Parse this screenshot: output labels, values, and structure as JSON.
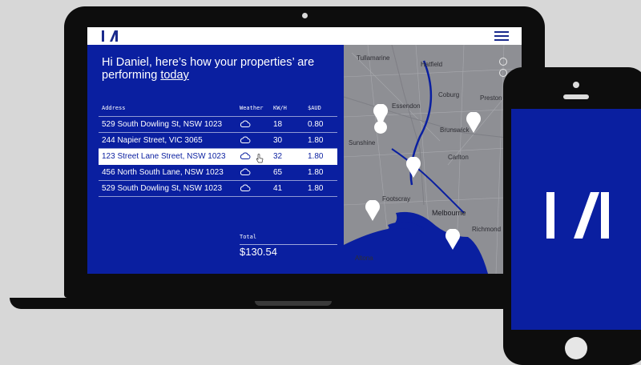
{
  "app": {
    "logo": "I/I",
    "menu_icon": "hamburger-menu-icon"
  },
  "greeting": {
    "text": "Hi Daniel, here’s how your properties’ are performing ",
    "link": "today"
  },
  "table": {
    "headers": {
      "address": "Address",
      "weather": "Weather",
      "kwh": "KW/H",
      "aud": "$AUD"
    },
    "rows": [
      {
        "address": "529 South Dowling St, NSW 1023",
        "weather_icon": "cloud-icon",
        "kwh": "18",
        "aud": "0.80",
        "selected": false
      },
      {
        "address": "244 Napier Street, VIC 3065",
        "weather_icon": "cloud-icon",
        "kwh": "30",
        "aud": "1.80",
        "selected": false
      },
      {
        "address": "123 Street Lane Street, NSW 1023",
        "weather_icon": "cloud-icon",
        "kwh": "32",
        "aud": "1.80",
        "selected": true
      },
      {
        "address": "456 North South Lane, NSW 1023",
        "weather_icon": "cloud-icon",
        "kwh": "65",
        "aud": "1.80",
        "selected": false
      },
      {
        "address": "529 South Dowling St, NSW 1023",
        "weather_icon": "cloud-icon",
        "kwh": "41",
        "aud": "1.80",
        "selected": false
      }
    ]
  },
  "total": {
    "label": "Total",
    "value": "$130.54"
  },
  "map": {
    "labels": {
      "tullamarine": "Tullamarine",
      "hatfield": "Hatfield",
      "essendon": "Essendon",
      "coburg": "Coburg",
      "brunswick": "Brunswick",
      "preston": "Preston",
      "altona": "Altona",
      "footscray": "Footscray",
      "melbourne": "Melbourne",
      "carlton": "Carlton",
      "richmond": "Richmond",
      "sunshine": "Sunshine"
    }
  },
  "colors": {
    "brand_blue": "#0a1fa0",
    "background": "#d7d7d7",
    "device": "#0d0d0d"
  },
  "phone": {
    "logo": "I/I"
  }
}
